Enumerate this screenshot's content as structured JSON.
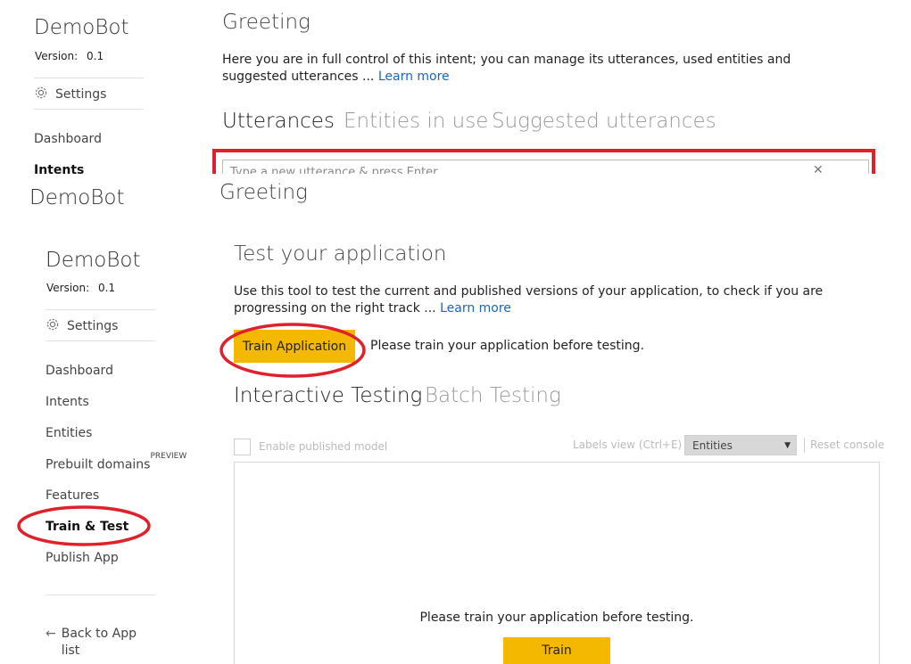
{
  "top": {
    "app_name": "DemoBot",
    "version_label": "Version:",
    "version_value": "0.1",
    "settings_label": "Settings",
    "nav_dashboard": "Dashboard",
    "nav_intents": "Intents",
    "page_title": "Greeting",
    "description": "Here you are in full control of this intent; you can manage its utterances, used entities and suggested utterances ...",
    "learn_more": "Learn more",
    "tabs": [
      "Utterances",
      "Entities in use",
      "Suggested utterances"
    ],
    "search_placeholder": "Type a new utterance & press Enter",
    "highlight_color": "#e0202a"
  },
  "mid": {
    "app_name": "DemoBot",
    "page_title": "Greeting"
  },
  "sidebar": {
    "app_name": "DemoBot",
    "version_label": "Version:",
    "version_value": "0.1",
    "settings_label": "Settings",
    "items": [
      {
        "label": "Dashboard"
      },
      {
        "label": "Intents"
      },
      {
        "label": "Entities"
      },
      {
        "label": "Prebuilt domains",
        "badge": "PREVIEW"
      },
      {
        "label": "Features"
      },
      {
        "label": "Train & Test",
        "active": true
      },
      {
        "label": "Publish App"
      }
    ],
    "back_label": "Back to App list"
  },
  "main": {
    "title": "Test your application",
    "description": "Use this tool to test the current and published versions of your application, to check if you are progressing on the right track ...",
    "learn_more": "Learn more",
    "train_button": "Train Application",
    "train_note": "Please train your application before testing.",
    "tabs": [
      "Interactive Testing",
      "Batch Testing"
    ],
    "enable_published": "Enable published model",
    "labels_view": "Labels view (Ctrl+E)",
    "entities_select": "Entities",
    "reset_console": "Reset console",
    "console_message": "Please train your application before testing.",
    "console_train_button": "Train"
  },
  "colors": {
    "accent_yellow": "#f5b800",
    "link_blue": "#1a64c8",
    "annotation_red": "#e0202a"
  }
}
